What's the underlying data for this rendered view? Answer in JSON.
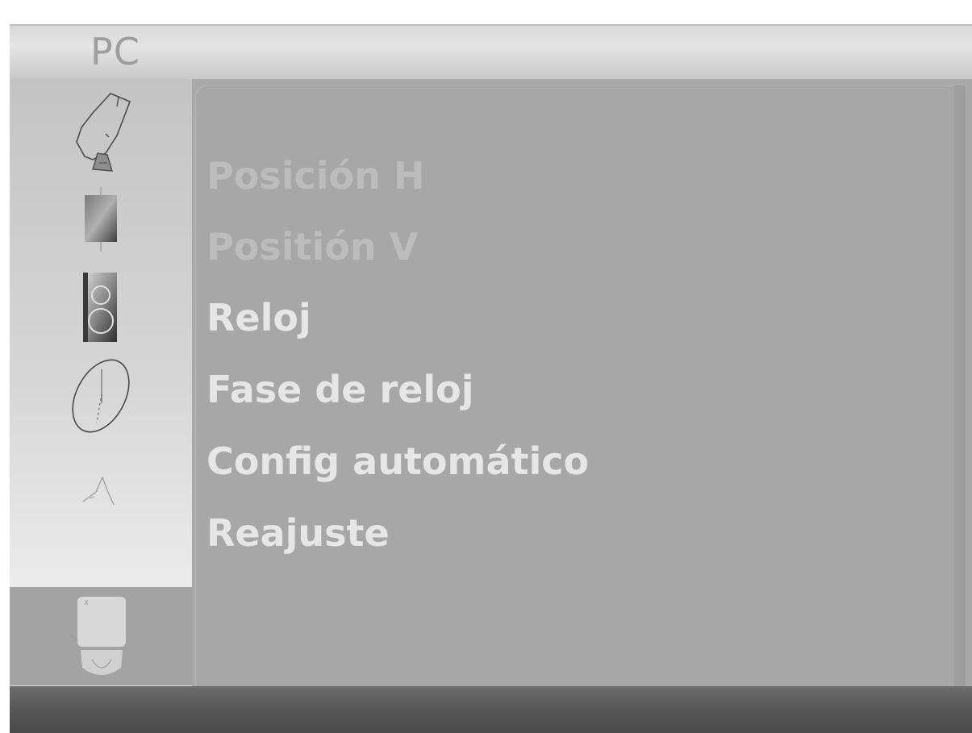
{
  "header": {
    "title": "PC"
  },
  "sidebar": {
    "items": [
      {
        "icon": "satellite-dish-icon",
        "selected": false
      },
      {
        "icon": "picture-square-icon",
        "selected": false
      },
      {
        "icon": "sound-speaker-icon",
        "selected": false
      },
      {
        "icon": "clock-time-icon",
        "selected": false
      },
      {
        "icon": "special-option-icon",
        "selected": false
      },
      {
        "icon": "pc-monitor-icon",
        "selected": true
      }
    ]
  },
  "menu": {
    "items": [
      {
        "label": "Posición H",
        "state": "disabled"
      },
      {
        "label": "Positión V",
        "state": "disabled"
      },
      {
        "label": "Reloj",
        "state": "enabled"
      },
      {
        "label": "Fase de reloj",
        "state": "enabled"
      },
      {
        "label": "Config automático",
        "state": "enabled"
      },
      {
        "label": "Reajuste",
        "state": "enabled"
      }
    ]
  },
  "colors": {
    "panel_background": "#a9a9a9",
    "title_bar": "#dcdcdc",
    "disabled_text": "#bcbcbc",
    "enabled_text": "#e6e6e6",
    "bottom_bar": "#5a5a5a"
  }
}
